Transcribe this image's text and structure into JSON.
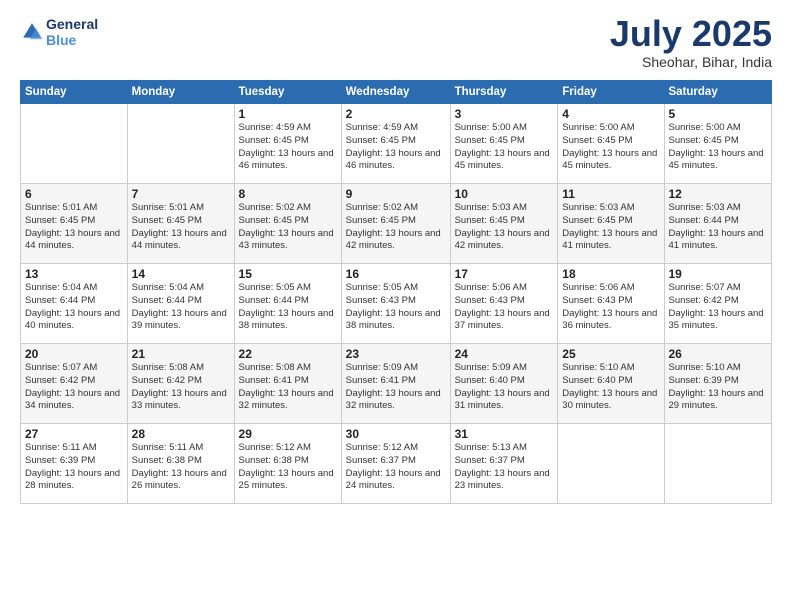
{
  "header": {
    "logo_line1": "General",
    "logo_line2": "Blue",
    "month_year": "July 2025",
    "location": "Sheohar, Bihar, India"
  },
  "days_of_week": [
    "Sunday",
    "Monday",
    "Tuesday",
    "Wednesday",
    "Thursday",
    "Friday",
    "Saturday"
  ],
  "weeks": [
    [
      {
        "day": "",
        "info": ""
      },
      {
        "day": "",
        "info": ""
      },
      {
        "day": "1",
        "info": "Sunrise: 4:59 AM\nSunset: 6:45 PM\nDaylight: 13 hours and 46 minutes."
      },
      {
        "day": "2",
        "info": "Sunrise: 4:59 AM\nSunset: 6:45 PM\nDaylight: 13 hours and 46 minutes."
      },
      {
        "day": "3",
        "info": "Sunrise: 5:00 AM\nSunset: 6:45 PM\nDaylight: 13 hours and 45 minutes."
      },
      {
        "day": "4",
        "info": "Sunrise: 5:00 AM\nSunset: 6:45 PM\nDaylight: 13 hours and 45 minutes."
      },
      {
        "day": "5",
        "info": "Sunrise: 5:00 AM\nSunset: 6:45 PM\nDaylight: 13 hours and 45 minutes."
      }
    ],
    [
      {
        "day": "6",
        "info": "Sunrise: 5:01 AM\nSunset: 6:45 PM\nDaylight: 13 hours and 44 minutes."
      },
      {
        "day": "7",
        "info": "Sunrise: 5:01 AM\nSunset: 6:45 PM\nDaylight: 13 hours and 44 minutes."
      },
      {
        "day": "8",
        "info": "Sunrise: 5:02 AM\nSunset: 6:45 PM\nDaylight: 13 hours and 43 minutes."
      },
      {
        "day": "9",
        "info": "Sunrise: 5:02 AM\nSunset: 6:45 PM\nDaylight: 13 hours and 42 minutes."
      },
      {
        "day": "10",
        "info": "Sunrise: 5:03 AM\nSunset: 6:45 PM\nDaylight: 13 hours and 42 minutes."
      },
      {
        "day": "11",
        "info": "Sunrise: 5:03 AM\nSunset: 6:45 PM\nDaylight: 13 hours and 41 minutes."
      },
      {
        "day": "12",
        "info": "Sunrise: 5:03 AM\nSunset: 6:44 PM\nDaylight: 13 hours and 41 minutes."
      }
    ],
    [
      {
        "day": "13",
        "info": "Sunrise: 5:04 AM\nSunset: 6:44 PM\nDaylight: 13 hours and 40 minutes."
      },
      {
        "day": "14",
        "info": "Sunrise: 5:04 AM\nSunset: 6:44 PM\nDaylight: 13 hours and 39 minutes."
      },
      {
        "day": "15",
        "info": "Sunrise: 5:05 AM\nSunset: 6:44 PM\nDaylight: 13 hours and 38 minutes."
      },
      {
        "day": "16",
        "info": "Sunrise: 5:05 AM\nSunset: 6:43 PM\nDaylight: 13 hours and 38 minutes."
      },
      {
        "day": "17",
        "info": "Sunrise: 5:06 AM\nSunset: 6:43 PM\nDaylight: 13 hours and 37 minutes."
      },
      {
        "day": "18",
        "info": "Sunrise: 5:06 AM\nSunset: 6:43 PM\nDaylight: 13 hours and 36 minutes."
      },
      {
        "day": "19",
        "info": "Sunrise: 5:07 AM\nSunset: 6:42 PM\nDaylight: 13 hours and 35 minutes."
      }
    ],
    [
      {
        "day": "20",
        "info": "Sunrise: 5:07 AM\nSunset: 6:42 PM\nDaylight: 13 hours and 34 minutes."
      },
      {
        "day": "21",
        "info": "Sunrise: 5:08 AM\nSunset: 6:42 PM\nDaylight: 13 hours and 33 minutes."
      },
      {
        "day": "22",
        "info": "Sunrise: 5:08 AM\nSunset: 6:41 PM\nDaylight: 13 hours and 32 minutes."
      },
      {
        "day": "23",
        "info": "Sunrise: 5:09 AM\nSunset: 6:41 PM\nDaylight: 13 hours and 32 minutes."
      },
      {
        "day": "24",
        "info": "Sunrise: 5:09 AM\nSunset: 6:40 PM\nDaylight: 13 hours and 31 minutes."
      },
      {
        "day": "25",
        "info": "Sunrise: 5:10 AM\nSunset: 6:40 PM\nDaylight: 13 hours and 30 minutes."
      },
      {
        "day": "26",
        "info": "Sunrise: 5:10 AM\nSunset: 6:39 PM\nDaylight: 13 hours and 29 minutes."
      }
    ],
    [
      {
        "day": "27",
        "info": "Sunrise: 5:11 AM\nSunset: 6:39 PM\nDaylight: 13 hours and 28 minutes."
      },
      {
        "day": "28",
        "info": "Sunrise: 5:11 AM\nSunset: 6:38 PM\nDaylight: 13 hours and 26 minutes."
      },
      {
        "day": "29",
        "info": "Sunrise: 5:12 AM\nSunset: 6:38 PM\nDaylight: 13 hours and 25 minutes."
      },
      {
        "day": "30",
        "info": "Sunrise: 5:12 AM\nSunset: 6:37 PM\nDaylight: 13 hours and 24 minutes."
      },
      {
        "day": "31",
        "info": "Sunrise: 5:13 AM\nSunset: 6:37 PM\nDaylight: 13 hours and 23 minutes."
      },
      {
        "day": "",
        "info": ""
      },
      {
        "day": "",
        "info": ""
      }
    ]
  ]
}
